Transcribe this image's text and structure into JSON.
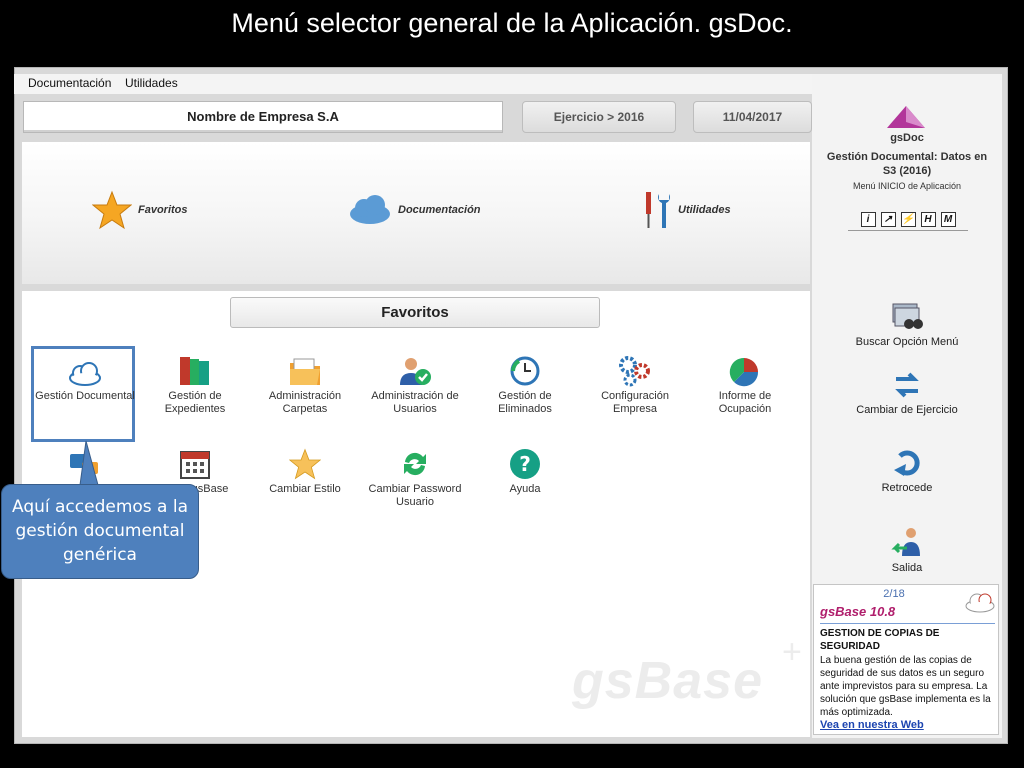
{
  "slide_title": "Menú selector general de la Aplicación. gsDoc.",
  "menubar": {
    "items": [
      "Documentación",
      "Utilidades"
    ]
  },
  "header": {
    "company": "Nombre de Empresa S.A",
    "ejercicio": "Ejercicio > 2016",
    "date": "11/04/2017"
  },
  "hero": {
    "favoritos": "Favoritos",
    "documentacion": "Documentación",
    "utilidades": "Utilidades"
  },
  "favorites": {
    "title": "Favoritos",
    "tiles": [
      {
        "label": "Gestión Documental",
        "icon": "cloud-icon"
      },
      {
        "label": "Gestión de Expedientes",
        "icon": "binders-icon"
      },
      {
        "label": "Administración Carpetas",
        "icon": "folder-icon"
      },
      {
        "label": "Administración de Usuarios",
        "icon": "user-check-icon"
      },
      {
        "label": "Gestión de Eliminados",
        "icon": "clock-restore-icon"
      },
      {
        "label": "Configuración Empresa",
        "icon": "gears-icon"
      },
      {
        "label": "Informe de Ocupación",
        "icon": "pie-chart-icon"
      },
      {
        "label": "",
        "icon": "chat-icon"
      },
      {
        "label": "gsBase",
        "icon": "calendar-icon"
      },
      {
        "label": "Cambiar Estilo",
        "icon": "star-icon"
      },
      {
        "label": "Cambiar Password Usuario",
        "icon": "refresh-icon"
      },
      {
        "label": "Ayuda",
        "icon": "help-icon"
      }
    ]
  },
  "sidebar": {
    "app_name": "gsDoc",
    "app_desc": "Gestión Documental: Datos en S3 (2016)",
    "app_sub": "Menú INICIO de Aplicación",
    "mini_icons": [
      "i",
      "↗",
      "⚡",
      "H",
      "M"
    ],
    "buttons": [
      {
        "label": "Buscar Opción Menú"
      },
      {
        "label": "Cambiar de Ejercicio"
      },
      {
        "label": "Retrocede"
      },
      {
        "label": "Salida"
      }
    ],
    "news": {
      "count": "2/18",
      "brand": "gsBase 10.8",
      "headline": "GESTION DE COPIAS DE SEGURIDAD",
      "body": "La buena gestión de las copias de seguridad de sus datos es un seguro ante imprevistos para su empresa. La solución que gsBase implementa es la más optimizada.",
      "link": "Vea en nuestra Web"
    }
  },
  "watermark": "gsBase",
  "watermark_plus": "+",
  "callout": "Aquí accedemos a la gestión documental genérica",
  "colors": {
    "callout": "#4e80bd",
    "news_brand": "#b01e6c",
    "link": "#1d45b0"
  }
}
